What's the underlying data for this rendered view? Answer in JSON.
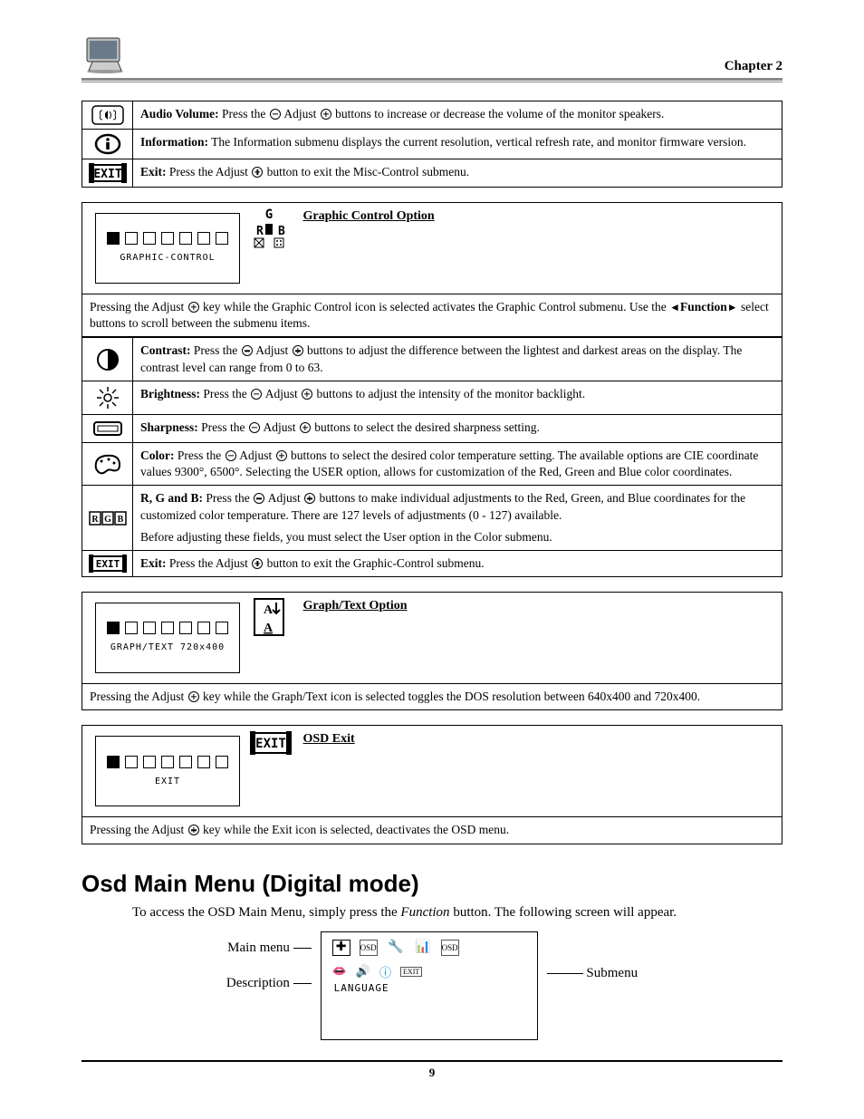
{
  "header": {
    "chapter": "Chapter 2"
  },
  "misc": {
    "audio": {
      "label": "Audio Volume:",
      "text": " Press the ",
      "text2": " Adjust ",
      "text3": " buttons to increase or decrease the volume of the monitor speakers."
    },
    "info": {
      "label": "Information:",
      "text": " The Information submenu displays the current resolution, vertical refresh rate, and monitor firmware version."
    },
    "exit": {
      "label": "Exit:",
      "text": " Press the Adjust ",
      "text2": " button to exit the Misc-Control submenu."
    }
  },
  "graphic": {
    "panel_label": "GRAPHIC-CONTROL",
    "title": "Graphic Control Option",
    "intro1": "Pressing the Adjust ",
    "intro2": " key while the Graphic Control icon is selected activates the Graphic Control submenu.  Use the ",
    "func": "Function",
    "intro3": " select buttons to scroll between the submenu items.",
    "contrast": {
      "label": "Contrast:",
      "t1": " Press the ",
      "t2": " Adjust ",
      "t3": " buttons to adjust the difference between the lightest and darkest areas on the display.  The contrast level can range from 0 to 63."
    },
    "brightness": {
      "label": "Brightness:",
      "t1": " Press the ",
      "t2": " Adjust ",
      "t3": " buttons to adjust the intensity of the monitor backlight."
    },
    "sharpness": {
      "label": "Sharpness:",
      "t1": " Press the ",
      "t2": " Adjust ",
      "t3": " buttons to select the desired sharpness setting."
    },
    "color": {
      "label": "Color:",
      "t1": " Press the ",
      "t2": " Adjust ",
      "t3": " buttons to select the desired color temperature setting.  The available options are CIE coordinate values 9300°, 6500°.  Selecting the USER option, allows for customization of the Red, Green and Blue color coordinates."
    },
    "rgb": {
      "label": "R, G and B:",
      "t1": " Press the ",
      "t2": " Adjust ",
      "t3": " buttons to make individual adjustments to the Red, Green, and Blue coordinates for the customized color temperature. There are 127 levels of adjustments (0 - 127) available.",
      "note": "Before adjusting these fields, you must select the User option in the Color submenu."
    },
    "exit": {
      "label": "Exit:",
      "t1": " Press the Adjust ",
      "t2": " button to exit the Graphic-Control submenu."
    }
  },
  "graphtext": {
    "panel_label": "GRAPH/TEXT  720x400",
    "title": "Graph/Text Option",
    "intro1": "Pressing the Adjust ",
    "intro2": " key while the Graph/Text icon is selected toggles the DOS resolution between 640x400 and 720x400."
  },
  "osdexit": {
    "panel_label": "EXIT",
    "title": "OSD Exit",
    "intro1": "Pressing the Adjust ",
    "intro2": " key while the Exit icon is selected, deactivates the OSD menu."
  },
  "digital": {
    "heading": "Osd Main Menu (Digital mode)",
    "intro1": "To access the OSD Main Menu, simply press the ",
    "func": "Function",
    "intro2": " button.  The following screen will appear.",
    "labels": {
      "main": "Main menu",
      "desc": "Description",
      "sub": "Submenu"
    },
    "screen_label": "LANGUAGE"
  },
  "page": "9"
}
